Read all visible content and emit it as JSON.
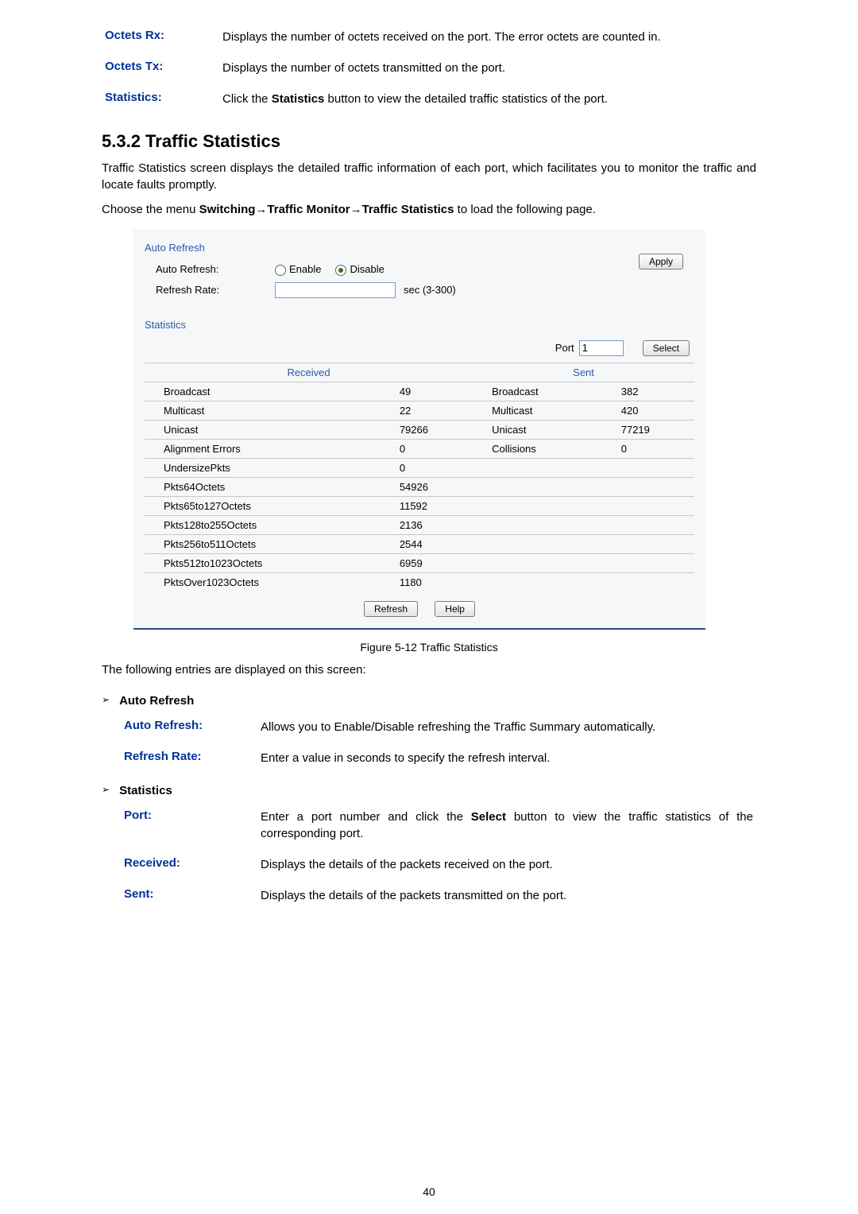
{
  "top_definitions": [
    {
      "term": "Octets Rx:",
      "def": "Displays the number of octets received on the port. The error octets are counted in."
    },
    {
      "term": "Octets Tx:",
      "def": "Displays the number of octets transmitted on the port."
    },
    {
      "term": "Statistics:",
      "def_before": "Click the ",
      "def_bold": "Statistics",
      "def_after": " button to view the detailed traffic statistics of the port."
    }
  ],
  "section_heading": "5.3.2 Traffic Statistics",
  "section_para": "Traffic Statistics screen displays the detailed traffic information of each port, which facilitates you to monitor the traffic and locate faults promptly.",
  "nav_line": {
    "pre": "Choose the menu ",
    "b1": "Switching",
    "arrow1": "→",
    "b2": "Traffic Monitor",
    "arrow2": "→",
    "b3": "Traffic Statistics",
    "post": " to load the following page."
  },
  "panel": {
    "auto_refresh_title": "Auto Refresh",
    "auto_refresh_label": "Auto Refresh:",
    "enable_label": "Enable",
    "disable_label": "Disable",
    "refresh_rate_label": "Refresh Rate:",
    "refresh_rate_value": "",
    "refresh_rate_unit": "sec (3-300)",
    "apply_label": "Apply",
    "statistics_title": "Statistics",
    "port_label": "Port",
    "port_value": "1",
    "select_label": "Select",
    "received_header": "Received",
    "sent_header": "Sent",
    "rows_paired": [
      {
        "rn": "Broadcast",
        "rv": "49",
        "sn": "Broadcast",
        "sv": "382"
      },
      {
        "rn": "Multicast",
        "rv": "22",
        "sn": "Multicast",
        "sv": "420"
      },
      {
        "rn": "Unicast",
        "rv": "79266",
        "sn": "Unicast",
        "sv": "77219"
      },
      {
        "rn": "Alignment Errors",
        "rv": "0",
        "sn": "Collisions",
        "sv": "0"
      }
    ],
    "rows_single": [
      {
        "rn": "UndersizePkts",
        "rv": "0"
      },
      {
        "rn": "Pkts64Octets",
        "rv": "54926"
      },
      {
        "rn": "Pkts65to127Octets",
        "rv": "11592"
      },
      {
        "rn": "Pkts128to255Octets",
        "rv": "2136"
      },
      {
        "rn": "Pkts256to511Octets",
        "rv": "2544"
      },
      {
        "rn": "Pkts512to1023Octets",
        "rv": "6959"
      },
      {
        "rn": "PktsOver1023Octets",
        "rv": "1180"
      }
    ],
    "refresh_button": "Refresh",
    "help_button": "Help"
  },
  "figure_caption": "Figure 5-12 Traffic Statistics",
  "following_entries": "The following entries are displayed on this screen:",
  "groups": [
    {
      "title": "Auto Refresh",
      "defs": [
        {
          "term": "Auto Refresh:",
          "def": "Allows you to Enable/Disable refreshing the Traffic Summary automatically."
        },
        {
          "term": "Refresh Rate:",
          "def": "Enter a value in seconds to specify the refresh interval."
        }
      ]
    },
    {
      "title": "Statistics",
      "defs": [
        {
          "term": "Port:",
          "def_before": "Enter a port number and click the ",
          "def_bold": "Select",
          "def_after": " button to view the traffic statistics of the corresponding port."
        },
        {
          "term": "Received:",
          "def": "Displays the details of the packets received on the port."
        },
        {
          "term": "Sent:",
          "def": "Displays the details of the packets transmitted on the port."
        }
      ]
    }
  ],
  "page_number": "40"
}
